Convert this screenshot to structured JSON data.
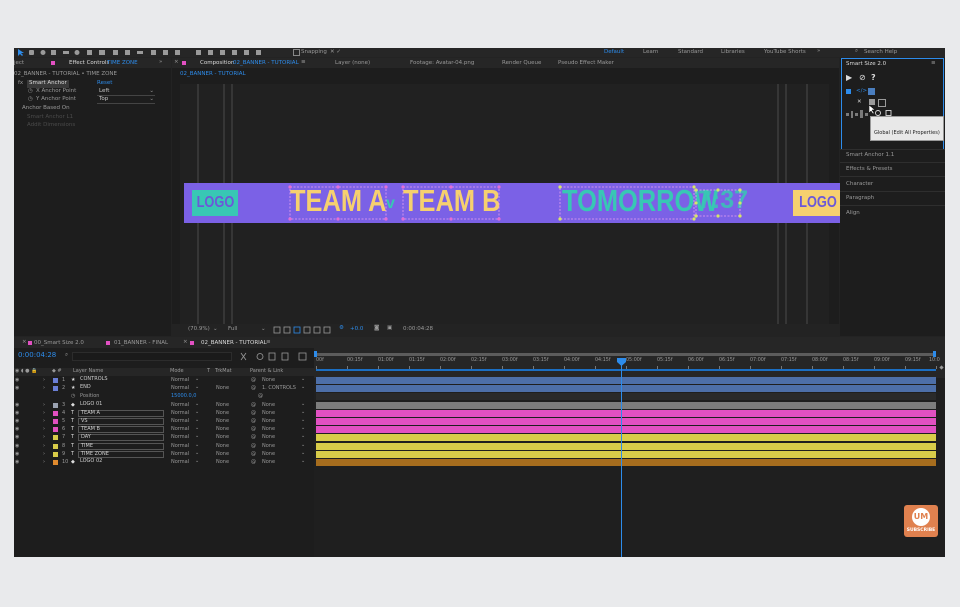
{
  "colors": {
    "accent": "#2d8ceb",
    "banner": "#7b61e6",
    "gold": "#f6d06f",
    "teal": "#38c7b4",
    "pink": "#e250c2",
    "yellow": "#d8cc49",
    "steel": "#4d6fa8",
    "orange": "#a66d1e"
  },
  "toolbar": {
    "snapping": "Snapping",
    "workspaces": [
      "Default",
      "Learn",
      "Standard",
      "Libraries",
      "YouTube Shorts"
    ],
    "active_workspace": "Default",
    "search": "Search Help"
  },
  "effect_controls": {
    "tab_left": "ject",
    "tab_prefix": "Effect Controls",
    "tab_layer": "TIME ZONE",
    "breadcrumb": "02_BANNER - TUTORIAL • TIME ZONE",
    "effect_name": "Smart Anchor",
    "reset": "Reset",
    "rows": [
      {
        "label": "X Anchor Point",
        "value": "Left"
      },
      {
        "label": "Y Anchor Point",
        "value": "Top"
      }
    ],
    "anchor_based_on": "Anchor Based On",
    "ghost1": "Smart Anchor L1",
    "ghost2": "Addit Dimensions"
  },
  "comp_tabs": {
    "composition_prefix": "Composition",
    "composition_name": "02_BANNER - TUTORIAL",
    "layer": "Layer (none)",
    "footage": "Footage: Avatar-04.png",
    "render_queue": "Render Queue",
    "pseudo": "Pseudo Effect Maker",
    "sub_tab": "02_BANNER - TUTORIAL"
  },
  "banner": {
    "logo_left": "LOGO",
    "team_a": "TEAM A",
    "vs": "v",
    "team_b": "TEAM B",
    "tomorrow": "TOMORROW",
    "time": "7:37",
    "logo_right": "LOGO"
  },
  "viewer_bar": {
    "zoom": "(70.9%)",
    "resolution": "Full",
    "exposure": "+0.0",
    "timecode": "0:00:04:28"
  },
  "smart_size": {
    "title": "Smart Size 2.0",
    "tooltip": "Global (Edit All Properties)",
    "sections": [
      "Smart Anchor 1.1",
      "Effects & Presets",
      "Character",
      "Paragraph",
      "Align"
    ]
  },
  "timeline_tabs": {
    "tab1": "00_Smart Size 2.0",
    "tab2": "01_BANNER - FINAL",
    "tab3": "02_BANNER - TUTORIAL"
  },
  "timeline": {
    "timecode": "0:00:04:28",
    "search_icon": "search-icon",
    "headers": {
      "layer_name": "Layer Name",
      "mode": "Mode",
      "t": "T",
      "trkmat": "TrkMat",
      "parent": "Parent & Link"
    },
    "position_label": "Position",
    "position_value": "15000.0,0",
    "layers": [
      {
        "num": "1",
        "name": "CONTROLS",
        "type": "★",
        "mode": "Normal",
        "trk": "",
        "parent": "None",
        "color": "#6b7fd6"
      },
      {
        "num": "2",
        "name": "END",
        "type": "★",
        "mode": "Normal",
        "trk": "None",
        "parent": "1. CONTROLS",
        "color": "#6b7fd6"
      },
      {
        "num": "3",
        "name": "LOGO 01",
        "type": "◆",
        "mode": "Normal",
        "trk": "None",
        "parent": "None",
        "color": "#9aa2b1"
      },
      {
        "num": "4",
        "name": "TEAM A",
        "type": "T",
        "mode": "Normal",
        "trk": "None",
        "parent": "None",
        "color": "#e250c2"
      },
      {
        "num": "5",
        "name": "VS",
        "type": "T",
        "mode": "Normal",
        "trk": "None",
        "parent": "None",
        "color": "#e250c2"
      },
      {
        "num": "6",
        "name": "TEAM B",
        "type": "T",
        "mode": "Normal",
        "trk": "None",
        "parent": "None",
        "color": "#e250c2"
      },
      {
        "num": "7",
        "name": "DAY",
        "type": "T",
        "mode": "Normal",
        "trk": "None",
        "parent": "None",
        "color": "#d8cc49"
      },
      {
        "num": "8",
        "name": "TIME",
        "type": "T",
        "mode": "Normal",
        "trk": "None",
        "parent": "None",
        "color": "#d8cc49"
      },
      {
        "num": "9",
        "name": "TIME ZONE",
        "type": "T",
        "mode": "Normal",
        "trk": "None",
        "parent": "None",
        "color": "#d8cc49"
      },
      {
        "num": "10",
        "name": "LOGO 02",
        "type": "◆",
        "mode": "Normal",
        "trk": "None",
        "parent": "None",
        "color": "#e08a2e"
      }
    ],
    "ruler": [
      "00f",
      "00:15f",
      "01:00f",
      "01:15f",
      "02:00f",
      "02:15f",
      "03:00f",
      "03:15f",
      "04:00f",
      "04:15f",
      "05:00f",
      "05:15f",
      "06:00f",
      "06:15f",
      "07:00f",
      "07:15f",
      "08:00f",
      "08:15f",
      "09:00f",
      "09:15f",
      "10:0"
    ]
  },
  "watermark": {
    "initials": "UM",
    "text": "SUBSCRIBE"
  }
}
